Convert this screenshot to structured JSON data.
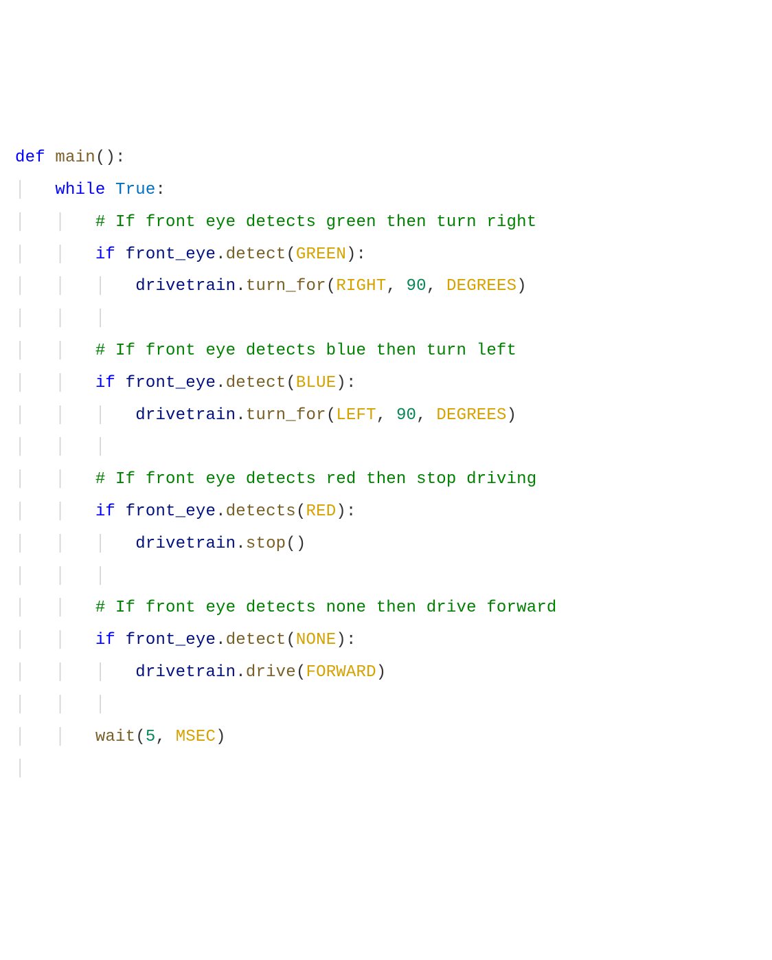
{
  "code": {
    "line1": {
      "def": "def",
      "main": "main",
      "paren": "():"
    },
    "line2": {
      "indent_guide": "│   ",
      "while_kw": "while",
      "true_const": "True",
      "colon": ":"
    },
    "line3": {
      "indent_guide": "│   │   ",
      "comment": "# If front eye detects green then turn right"
    },
    "line4": {
      "indent_guide": "│   │   ",
      "if_kw": "if",
      "obj": "front_eye",
      "dot": ".",
      "method": "detect",
      "lparen": "(",
      "arg": "GREEN",
      "rparen_colon": "):"
    },
    "line5": {
      "indent_guide": "│   │   │   ",
      "obj": "drivetrain",
      "dot": ".",
      "method": "turn_for",
      "lparen": "(",
      "arg1": "RIGHT",
      "comma1": ", ",
      "arg2": "90",
      "comma2": ", ",
      "arg3": "DEGREES",
      "rparen": ")"
    },
    "line6": {
      "indent_guide": "│   │   │"
    },
    "line7": {
      "indent_guide": "│   │   ",
      "comment": "# If front eye detects blue then turn left"
    },
    "line8": {
      "indent_guide": "│   │   ",
      "if_kw": "if",
      "obj": "front_eye",
      "dot": ".",
      "method": "detect",
      "lparen": "(",
      "arg": "BLUE",
      "rparen_colon": "):"
    },
    "line9": {
      "indent_guide": "│   │   │   ",
      "obj": "drivetrain",
      "dot": ".",
      "method": "turn_for",
      "lparen": "(",
      "arg1": "LEFT",
      "comma1": ", ",
      "arg2": "90",
      "comma2": ", ",
      "arg3": "DEGREES",
      "rparen": ")"
    },
    "line10": {
      "indent_guide": "│   │   │"
    },
    "line11": {
      "indent_guide": "│   │   ",
      "comment": "# If front eye detects red then stop driving"
    },
    "line12": {
      "indent_guide": "│   │   ",
      "if_kw": "if",
      "obj": "front_eye",
      "dot": ".",
      "method": "detects",
      "lparen": "(",
      "arg": "RED",
      "rparen_colon": "):"
    },
    "line13": {
      "indent_guide": "│   │   │   ",
      "obj": "drivetrain",
      "dot": ".",
      "method": "stop",
      "paren": "()"
    },
    "line14": {
      "indent_guide": "│   │   │"
    },
    "line15": {
      "indent_guide": "│   │   ",
      "comment": "# If front eye detects none then drive forward"
    },
    "line16": {
      "indent_guide": "│   │   ",
      "if_kw": "if",
      "obj": "front_eye",
      "dot": ".",
      "method": "detect",
      "lparen": "(",
      "arg": "NONE",
      "rparen_colon": "):"
    },
    "line17": {
      "indent_guide": "│   │   │   ",
      "obj": "drivetrain",
      "dot": ".",
      "method": "drive",
      "lparen": "(",
      "arg": "FORWARD",
      "rparen": ")"
    },
    "line18": {
      "indent_guide": "│   │   │"
    },
    "line19": {
      "indent_guide": "│   │   ",
      "method": "wait",
      "lparen": "(",
      "arg1": "5",
      "comma": ", ",
      "arg2": "MSEC",
      "rparen": ")"
    },
    "line20": {
      "indent_guide": "│"
    }
  }
}
